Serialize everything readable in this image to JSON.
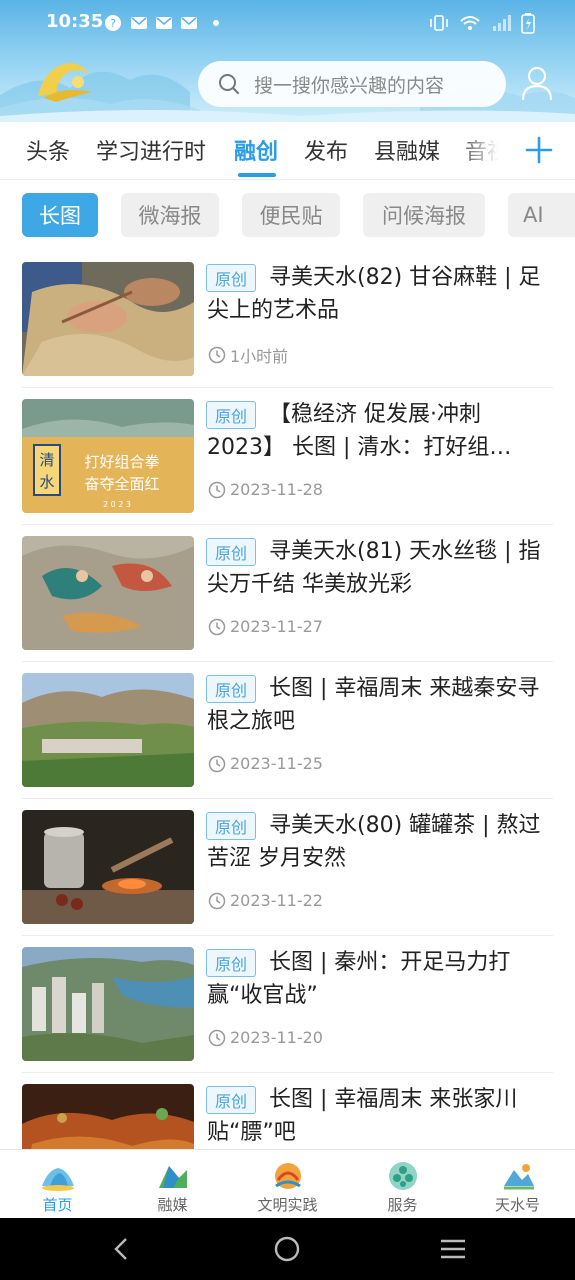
{
  "status_bar": {
    "time": "10:35"
  },
  "search": {
    "placeholder": "搜一搜你感兴趣的内容"
  },
  "channels": [
    {
      "label": "头条"
    },
    {
      "label": "学习进行时"
    },
    {
      "label": "融创"
    },
    {
      "label": "发布"
    },
    {
      "label": "县融媒"
    },
    {
      "label": "音视"
    }
  ],
  "active_channel": "融创",
  "subtabs": [
    {
      "label": "长图"
    },
    {
      "label": "微海报"
    },
    {
      "label": "便民贴"
    },
    {
      "label": "问候海报"
    },
    {
      "label": "AI"
    }
  ],
  "articles": [
    {
      "badge": "原创",
      "title": "寻美天水(82) 甘谷麻鞋 | 足尖上的艺术品",
      "date": "1小时前"
    },
    {
      "badge": "原创",
      "title": "【稳经济 促发展·冲刺2023】 长图 | 清水：打好组…",
      "date": "2023-11-28",
      "thumb_text_1": "清",
      "thumb_text_2": "水",
      "thumb_caption_1": "打好组合拳",
      "thumb_caption_2": "奋夺全面红",
      "thumb_year": "2 0 2 3"
    },
    {
      "badge": "原创",
      "title": "寻美天水(81) 天水丝毯 | 指尖万千结 华美放光彩",
      "date": "2023-11-27"
    },
    {
      "badge": "原创",
      "title": "长图 | 幸福周末 来越秦安寻根之旅吧",
      "date": "2023-11-25"
    },
    {
      "badge": "原创",
      "title": "寻美天水(80) 罐罐茶 | 熬过苦涩 岁月安然",
      "date": "2023-11-22"
    },
    {
      "badge": "原创",
      "title": "长图 | 秦州：开足马力打赢“收官战”",
      "date": "2023-11-20"
    },
    {
      "badge": "原创",
      "title": "长图 | 幸福周末 来张家川贴“膘”吧",
      "date": ""
    }
  ],
  "bottom_nav": [
    {
      "label": "首页"
    },
    {
      "label": "融媒"
    },
    {
      "label": "文明实践"
    },
    {
      "label": "服务"
    },
    {
      "label": "天水号"
    }
  ],
  "colors": {
    "accent": "#2b9de6",
    "header_top": "#5ab3e6",
    "badge": "#4aa5dd"
  }
}
